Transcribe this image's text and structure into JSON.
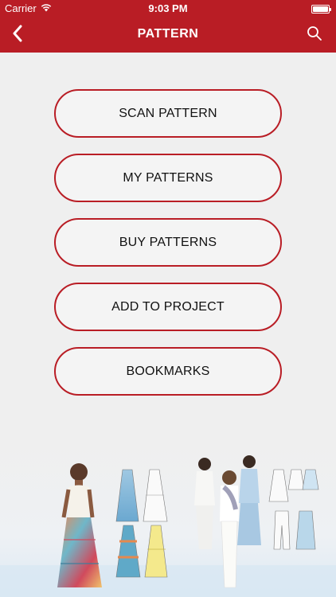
{
  "status_bar": {
    "carrier": "Carrier",
    "time": "9:03 PM",
    "icons": [
      "wifi-icon",
      "battery-icon"
    ]
  },
  "nav": {
    "title": "PATTERN",
    "back_icon": "chevron-left-icon",
    "search_icon": "search-icon"
  },
  "menu": {
    "items": [
      {
        "label": "SCAN PATTERN"
      },
      {
        "label": "MY PATTERNS"
      },
      {
        "label": "BUY PATTERNS"
      },
      {
        "label": "ADD TO PROJECT"
      },
      {
        "label": "BOOKMARKS"
      }
    ]
  },
  "colors": {
    "accent": "#b91d25",
    "background": "#efefef",
    "button_text": "#111111"
  }
}
